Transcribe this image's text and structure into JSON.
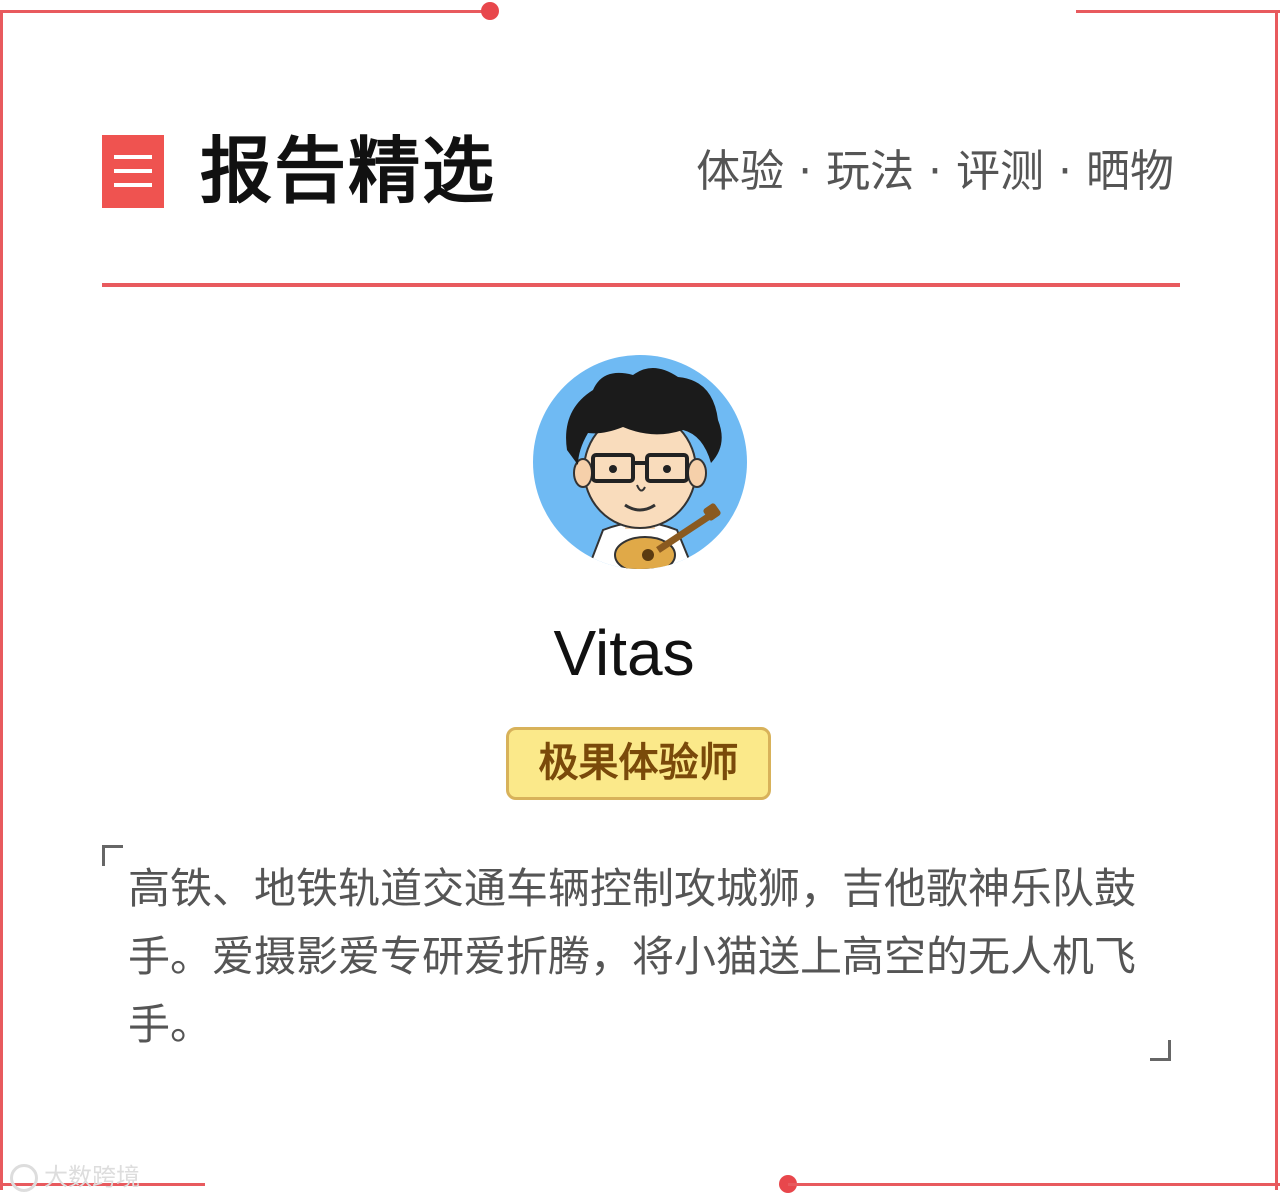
{
  "header": {
    "title": "报告精选",
    "tags": "体验 · 玩法 · 评测 · 晒物"
  },
  "profile": {
    "name": "Vitas",
    "badge": "极果体验师",
    "bio": "高铁、地铁轨道交通车辆控制攻城狮，吉他歌神乐队鼓手。爱摄影爱专研爱折腾，将小猫送上高空的无人机飞手。"
  },
  "watermark": {
    "text": "大数跨境"
  },
  "colors": {
    "accent": "#e85a5e",
    "badge_bg": "#fbe98a",
    "badge_text": "#7a4a0a"
  },
  "icons": {
    "menu": "menu-icon",
    "avatar": "cartoon-avatar"
  }
}
